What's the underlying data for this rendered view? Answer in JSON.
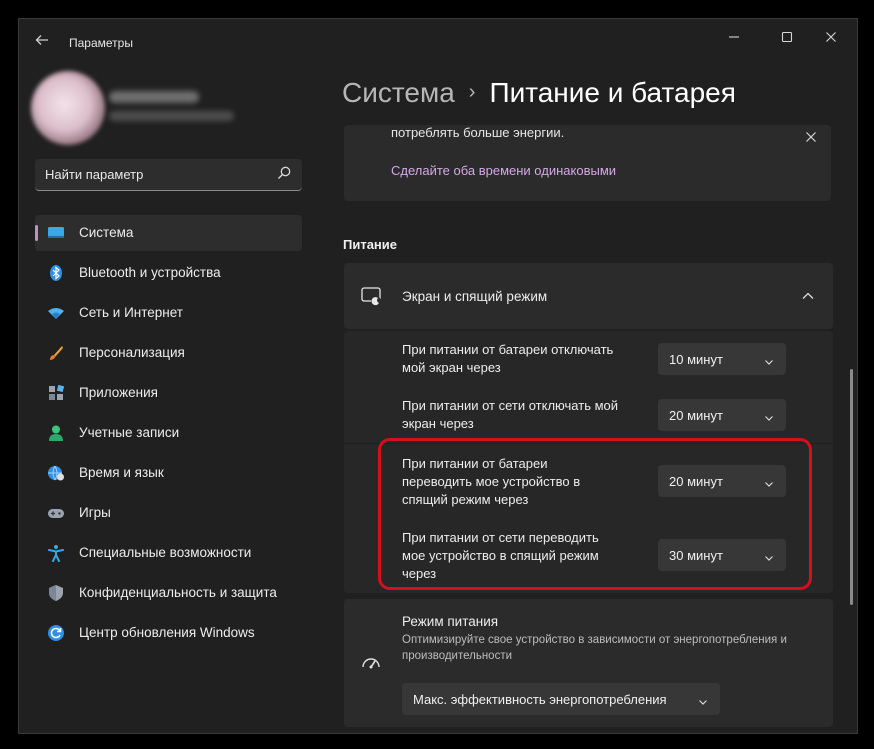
{
  "window": {
    "title": "Параметры",
    "controls": [
      "minimize",
      "maximize",
      "close"
    ]
  },
  "search": {
    "value": "Найти параметр"
  },
  "sidebar": {
    "items": [
      {
        "label": "Система",
        "icon": "system-icon",
        "active": true
      },
      {
        "label": "Bluetooth и устройства",
        "icon": "bluetooth-icon"
      },
      {
        "label": "Сеть и Интернет",
        "icon": "wifi-icon"
      },
      {
        "label": "Персонализация",
        "icon": "brush-icon"
      },
      {
        "label": "Приложения",
        "icon": "apps-icon"
      },
      {
        "label": "Учетные записи",
        "icon": "person-icon"
      },
      {
        "label": "Время и язык",
        "icon": "globe-clock-icon"
      },
      {
        "label": "Игры",
        "icon": "gamepad-icon"
      },
      {
        "label": "Специальные возможности",
        "icon": "accessibility-icon"
      },
      {
        "label": "Конфиденциальность и защита",
        "icon": "shield-icon"
      },
      {
        "label": "Центр обновления Windows",
        "icon": "update-icon"
      }
    ]
  },
  "breadcrumb": {
    "parent": "Система",
    "separator": "›",
    "current": "Питание и батарея"
  },
  "tip": {
    "text": "потреблять больше энергии.",
    "link": "Сделайте оба времени одинаковыми"
  },
  "power": {
    "section_title": "Питание",
    "screen_sleep": {
      "title": "Экран и спящий режим",
      "rows": [
        {
          "label_lines": [
            "При питании от батареи отключать",
            "мой экран через"
          ],
          "value": "10 минут"
        },
        {
          "label_lines": [
            "При питании от сети отключать мой",
            "экран через"
          ],
          "value": "20 минут"
        },
        {
          "label_lines": [
            "При питании от батареи",
            "переводить мое устройство в",
            "спящий режим через"
          ],
          "value": "20 минут"
        },
        {
          "label_lines": [
            "При питании от сети переводить",
            "мое устройство в спящий режим",
            "через"
          ],
          "value": "30 минут"
        }
      ]
    },
    "power_mode": {
      "title": "Режим питания",
      "description": "Оптимизируйте свое устройство в зависимости от энергопотребления и производительности",
      "value": "Макс. эффективность энергопотребления"
    }
  },
  "colors": {
    "accent": "#c28fc3",
    "link": "#d5a8e6",
    "highlight": "#d4101d"
  }
}
